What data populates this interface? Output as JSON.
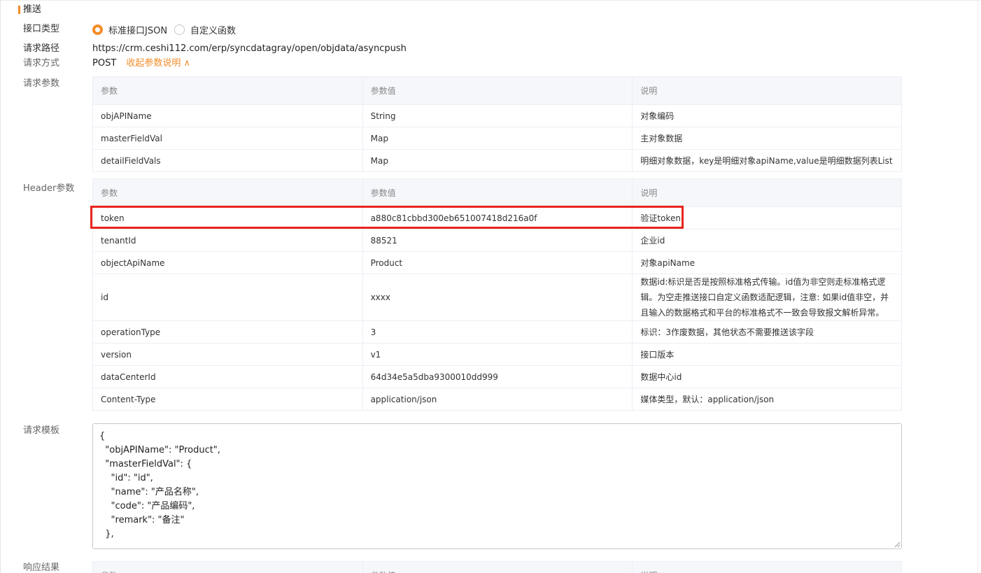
{
  "section": {
    "title": "推送"
  },
  "interface_type": {
    "label": "接口类型",
    "options": [
      {
        "label": "标准接口JSON",
        "selected": true
      },
      {
        "label": "自定义函数",
        "selected": false
      }
    ]
  },
  "request_path": {
    "label": "请求路径",
    "value": "https://crm.ceshi112.com/erp/syncdatagray/open/objdata/asyncpush"
  },
  "request_method": {
    "label": "请求方式",
    "value": "POST",
    "toggle_label": "收起参数说明 ∧"
  },
  "request_params": {
    "label": "请求参数",
    "headers": [
      "参数",
      "参数值",
      "说明"
    ],
    "rows": [
      [
        "objAPIName",
        "String",
        "对象编码"
      ],
      [
        "masterFieldVal",
        "Map",
        "主对象数据"
      ],
      [
        "detailFieldVals",
        "Map",
        "明细对象数据，key是明细对象apiName,value是明细数据列表List"
      ]
    ]
  },
  "header_params": {
    "label": "Header参数",
    "headers": [
      "参数",
      "参数值",
      "说明"
    ],
    "rows": [
      [
        "token",
        "a880c81cbbd300eb651007418d216a0f",
        "验证token"
      ],
      [
        "tenantId",
        "88521",
        "企业id"
      ],
      [
        "objectApiName",
        "Product",
        "对象apiName"
      ],
      [
        "id",
        "xxxx",
        "数据id:标识是否是按照标准格式传输。id值为非空则走标准格式逻辑。为空走推送接口自定义函数适配逻辑，注意: 如果id值非空，并且输入的数据格式和平台的标准格式不一致会导致报文解析异常。"
      ],
      [
        "operationType",
        "3",
        "标识：3作废数据，其他状态不需要推送该字段"
      ],
      [
        "version",
        "v1",
        "接口版本"
      ],
      [
        "dataCenterId",
        "64d34e5a5dba9300010dd999",
        "数据中心id"
      ],
      [
        "Content-Type",
        "application/json",
        "媒体类型，默认：application/json"
      ]
    ]
  },
  "request_template": {
    "label": "请求模板",
    "value": "{\n  \"objAPIName\": \"Product\",\n  \"masterFieldVal\": {\n    \"id\": \"id\",\n    \"name\": \"产品名称\",\n    \"code\": \"产品编码\",\n    \"remark\": \"备注\"\n  },"
  },
  "response_result": {
    "label": "响应结果",
    "headers": [
      "参数",
      "参数值",
      "说明"
    ]
  },
  "colors": {
    "accent": "#f28c28",
    "highlight": "#e8251c"
  }
}
